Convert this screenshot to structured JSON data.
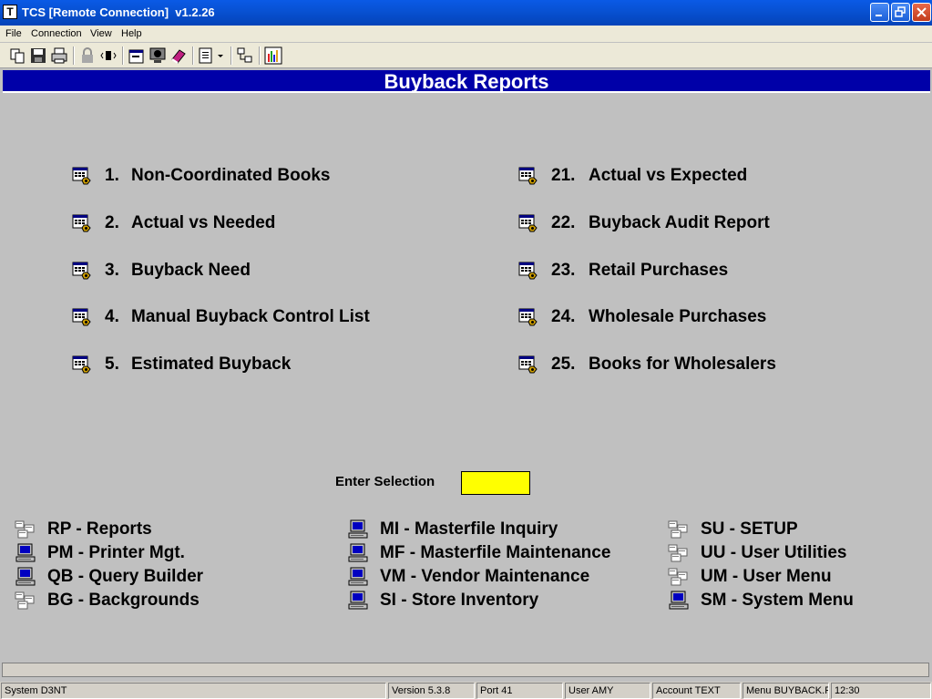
{
  "window": {
    "title": "TCS [Remote Connection]  v1.2.26"
  },
  "menu": [
    "File",
    "Connection",
    "View",
    "Help"
  ],
  "toolbar_icons": [
    "copy-icon",
    "save-icon",
    "print-icon",
    "lock-icon",
    "sound-icon",
    "properties-icon",
    "monitor-icon",
    "book-icon",
    "document-dropdown-icon",
    "network-icon",
    "chart-icon"
  ],
  "header": {
    "title": "Buyback Reports"
  },
  "reports_left": [
    {
      "num": "1.",
      "label": "Non-Coordinated Books"
    },
    {
      "num": "2.",
      "label": "Actual vs Needed"
    },
    {
      "num": "3.",
      "label": "Buyback Need"
    },
    {
      "num": "4.",
      "label": "Manual Buyback Control List"
    },
    {
      "num": "5.",
      "label": "Estimated Buyback"
    }
  ],
  "reports_right": [
    {
      "num": "21.",
      "label": "Actual vs Expected"
    },
    {
      "num": "22.",
      "label": "Buyback Audit Report"
    },
    {
      "num": "23.",
      "label": "Retail Purchases"
    },
    {
      "num": "24.",
      "label": "Wholesale Purchases"
    },
    {
      "num": "25.",
      "label": "Books for Wholesalers"
    }
  ],
  "selection": {
    "label": "Enter Selection",
    "value": "",
    "color": "#ffff00"
  },
  "nav_col1": [
    {
      "label": "RP - Reports",
      "icon": "menu-icon"
    },
    {
      "label": "PM - Printer Mgt.",
      "icon": "computer-icon"
    },
    {
      "label": "QB - Query Builder",
      "icon": "computer-icon"
    },
    {
      "label": "BG - Backgrounds",
      "icon": "menu-icon"
    }
  ],
  "nav_col2": [
    {
      "label": "MI - Masterfile Inquiry",
      "icon": "computer-icon"
    },
    {
      "label": "MF - Masterfile Maintenance",
      "icon": "computer-icon"
    },
    {
      "label": "VM - Vendor Maintenance",
      "icon": "computer-icon"
    },
    {
      "label": "SI - Store Inventory",
      "icon": "computer-icon"
    }
  ],
  "nav_col3": [
    {
      "label": "SU - SETUP",
      "icon": "menu-icon"
    },
    {
      "label": "UU - User Utilities",
      "icon": "menu-icon"
    },
    {
      "label": "UM - User Menu",
      "icon": "menu-icon"
    },
    {
      "label": "SM - System Menu",
      "icon": "computer-icon"
    }
  ],
  "status": {
    "system": "System D3NT",
    "version": "Version 5.3.8",
    "port": "Port 41",
    "user": "User AMY",
    "account": "Account TEXT",
    "menu": "Menu BUYBACK.R",
    "time": "12:30"
  }
}
